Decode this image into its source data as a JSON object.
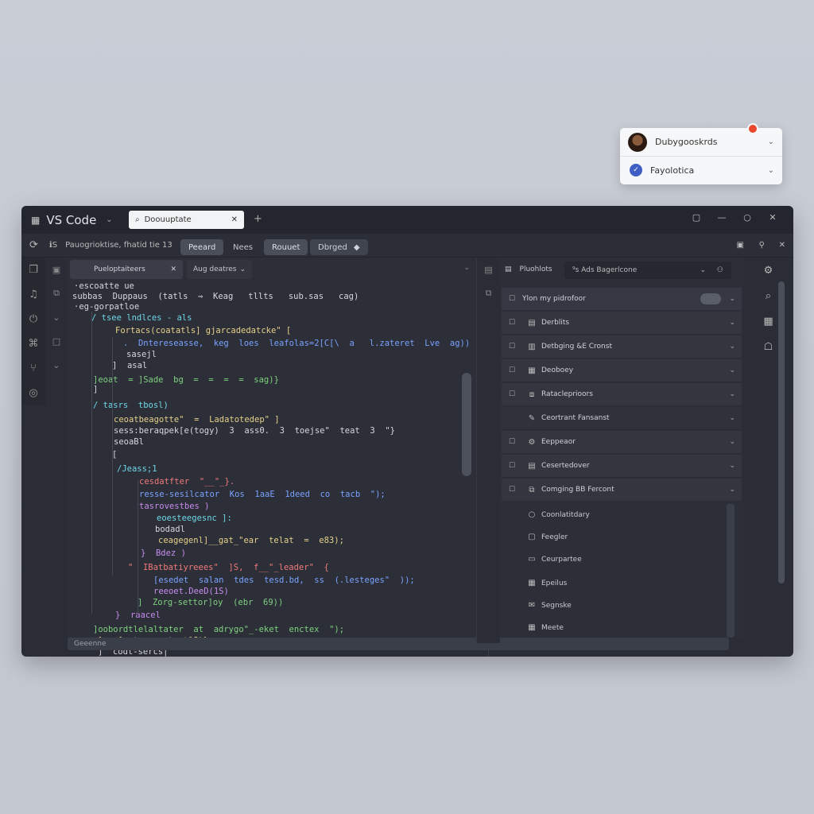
{
  "account_card": {
    "user_name": "Dubygooskrds",
    "workspace_name": "Fayolotica",
    "notification_count": ""
  },
  "window": {
    "app_title": "VS Code",
    "active_tab": "Doouuptate",
    "window_controls": [
      "▢",
      "—",
      "○",
      "✕"
    ]
  },
  "toolbar": {
    "left_text": "ℹS",
    "breadcrumb": "Pauogrioktise,  fhatid tie 13",
    "pill1": "Peeard",
    "pill2": "Nees",
    "pill3": "Rouuet",
    "pill4": "Dbrged"
  },
  "editor": {
    "tab1_label": "Pueloptaiteers",
    "tab2_label": "Aug deatres",
    "code_lines": [
      {
        "t": "·escoatte ue",
        "c": "c-w"
      },
      {
        "t": "subbas  Duppaus  (tatls  ⇒  Keag   tllts   sub.sas   cag)",
        "c": "c-w"
      },
      {
        "t": "·eg-gorpatloe",
        "c": "c-w"
      },
      {
        "t": "/ tsee lndlces - als",
        "c": "c-c"
      },
      {
        "t": "Fortacs(coatatls] gjarcadedatcke\" [",
        "c": "c-y"
      },
      {
        "t": ".  Dntereseasse,  keg  loes  leafolas=2[C[\\  a   l.zateret  Lve  ag))",
        "c": "c-b"
      },
      {
        "t": "sasejl",
        "c": "c-w"
      },
      {
        "t": "]  asal",
        "c": "c-w"
      },
      {
        "t": "]eoat  = ]Sade  bg  =  =  =  =  sag)}",
        "c": "c-g"
      },
      {
        "t": "]",
        "c": "c-w"
      },
      {
        "t": "/ tasrs  tbosl)",
        "c": "c-c"
      },
      {
        "t": "ceoatbeagotte\"  =  Ladatotedep\" ]",
        "c": "c-y"
      },
      {
        "t": "sess:beraqpek[e(togy)  3  ass0.  3  toejse\"  teat  3  \"}",
        "c": "c-w"
      },
      {
        "t": "seoaBl",
        "c": "c-w"
      },
      {
        "t": "[",
        "c": "c-w"
      },
      {
        "t": "/Jeass;1",
        "c": "c-c"
      },
      {
        "t": "cesdatfter  \"__\"_}.",
        "c": "c-r"
      },
      {
        "t": "resse-sesilcator  Kos  1aaE  1deed  co  tacb  \");",
        "c": "c-b"
      },
      {
        "t": "tasrovestbes )",
        "c": "c-p"
      },
      {
        "t": "eoesteegesnc ]:",
        "c": "c-c"
      },
      {
        "t": "bodadl",
        "c": "c-w"
      },
      {
        "t": "ceagegenl]__gat_\"ear  telat  =  e83);",
        "c": "c-y"
      },
      {
        "t": "}  Bdez )",
        "c": "c-p"
      },
      {
        "t": "\"  IBatbatiyreees\"  ]S,  f__\"_leader\"  {",
        "c": "c-r"
      },
      {
        "t": "[esedet  salan  tdes  tesd.bd,  ss  (.lesteges\"  ));",
        "c": "c-b"
      },
      {
        "t": "reeoet.DeeD(1S)",
        "c": "c-p"
      },
      {
        "t": "]  Zorg-settor]oy  (ebr  69))",
        "c": "c-g"
      },
      {
        "t": "}  raacel",
        "c": "c-p"
      },
      {
        "t": "]oobordtlelaltater  at  adrygo\"_-eket  enctex  \");",
        "c": "c-g"
      },
      {
        "t": "]  c[sptsper  toat]S)}",
        "c": "c-y"
      },
      {
        "t": "]  codt-sercs|",
        "c": "c-w"
      }
    ]
  },
  "statusbar": {
    "text": "Geeenne"
  },
  "panel": {
    "title": "Pluohlots",
    "search_text": "⁹s  Ads  Bagerlcone",
    "top_row": "Ylon my pidrofoor",
    "sections": [
      "Derblits",
      "Detbging &E Cronst",
      "Deoboey",
      "Ratacleprioors",
      "Ceortrant Fansanst",
      "Eeppeaor",
      "Cesertedover",
      "Comging BB Fercont"
    ],
    "sub_items": [
      "Coonlatitdary",
      "Feegler",
      "Ceurpartee",
      "Epeilus",
      "Segnske",
      "Meete"
    ]
  }
}
